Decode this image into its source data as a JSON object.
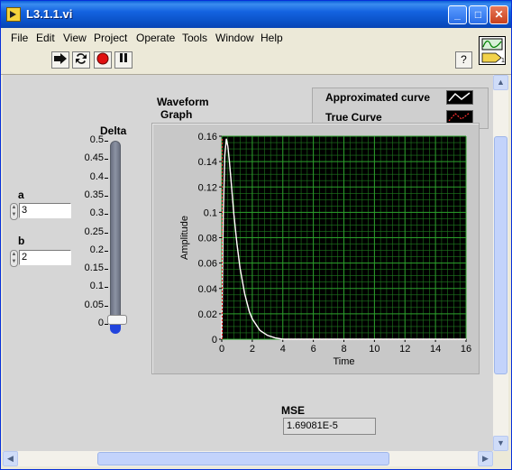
{
  "window": {
    "title": "L3.1.1.vi"
  },
  "title_buttons": {
    "minimize": "_",
    "maximize": "□",
    "close": "✕"
  },
  "menu": [
    "File",
    "Edit",
    "View",
    "Project",
    "Operate",
    "Tools",
    "Window",
    "Help"
  ],
  "toolbar": {
    "help": "?"
  },
  "vi_icon_badge": "1",
  "controls": {
    "a": {
      "label": "a",
      "value": "3"
    },
    "b": {
      "label": "b",
      "value": "2"
    },
    "delta": {
      "label": "Delta",
      "ticks": [
        "0.5",
        "0.45",
        "0.4",
        "0.35",
        "0.3",
        "0.25",
        "0.2",
        "0.15",
        "0.1",
        "0.05",
        "0"
      ],
      "value": 0.0
    }
  },
  "graph": {
    "label_line1": "Waveform",
    "label_line2": "Graph",
    "legend": [
      {
        "name": "Approximated curve",
        "color": "#ffffff"
      },
      {
        "name": "True Curve",
        "color": "#ff3030"
      }
    ]
  },
  "chart_data": {
    "type": "line",
    "xlabel": "Time",
    "ylabel": "Amplitude",
    "xlim": [
      0,
      16
    ],
    "ylim": [
      0,
      0.16
    ],
    "xticks": [
      "0",
      "2",
      "4",
      "6",
      "8",
      "10",
      "12",
      "14",
      "16"
    ],
    "yticks": [
      "0",
      "0.02",
      "0.04",
      "0.06",
      "0.08",
      "0.1",
      "0.12",
      "0.14",
      "0.16"
    ],
    "grid": true,
    "colors": {
      "plot_bg": "#000000",
      "grid": "#1f7a1f",
      "major_grid": "#2ca02c"
    },
    "series": [
      {
        "name": "Approximated curve",
        "color": "#ffffff",
        "x": [
          0,
          0.1,
          0.2,
          0.3,
          0.4,
          0.5,
          0.6,
          0.8,
          1.0,
          1.2,
          1.5,
          1.8,
          2.0,
          2.5,
          3.0,
          3.5,
          4.0
        ],
        "y": [
          0,
          0.098,
          0.145,
          0.158,
          0.152,
          0.14,
          0.126,
          0.098,
          0.075,
          0.056,
          0.036,
          0.022,
          0.016,
          0.007,
          0.003,
          0.001,
          0.0
        ]
      },
      {
        "name": "True Curve",
        "color": "#ff3030",
        "x": [
          0,
          0.1,
          0.2,
          0.3,
          0.4,
          0.5,
          0.6,
          0.8,
          1.0,
          1.2,
          1.5,
          1.8,
          2.0,
          2.5,
          3.0,
          3.5,
          4.0
        ],
        "y": [
          0,
          0.098,
          0.145,
          0.158,
          0.152,
          0.14,
          0.126,
          0.098,
          0.075,
          0.056,
          0.036,
          0.022,
          0.016,
          0.007,
          0.003,
          0.001,
          0.0
        ]
      }
    ]
  },
  "mse": {
    "label": "MSE",
    "value": "1.69081E-5"
  }
}
